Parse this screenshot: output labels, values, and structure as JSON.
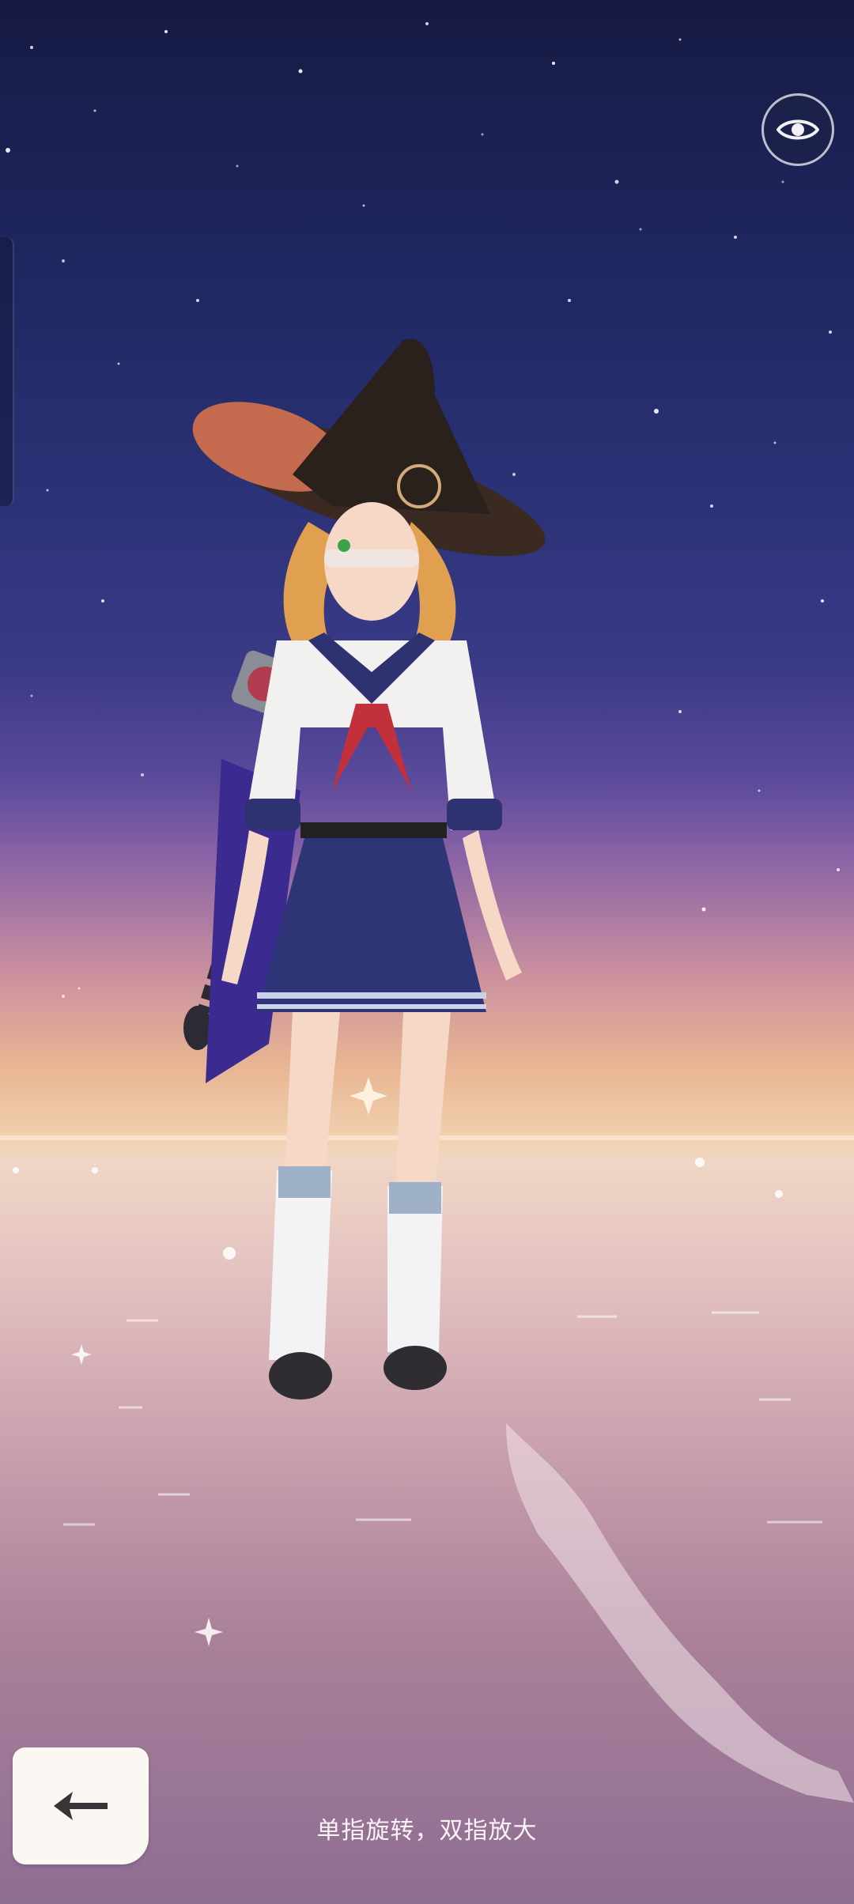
{
  "viewer": {
    "visibility_toggle_icon": "eye-icon",
    "back_icon": "arrow-left-icon",
    "hint_text": "单指旋转，双指放大"
  },
  "colors": {
    "sky_top": "#161a43",
    "sky_mid": "#3a3a87",
    "horizon_glow": "#f2d2b0",
    "water": "#c9a0ae",
    "button_bg": "#fbf7f2"
  }
}
